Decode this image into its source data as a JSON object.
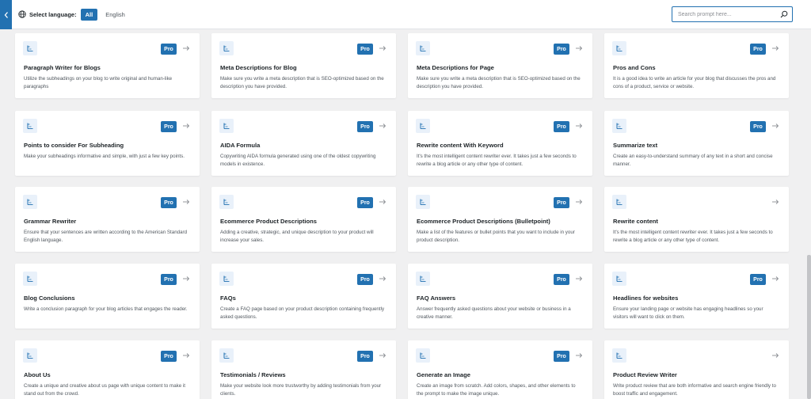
{
  "topbar": {
    "language_label": "Select language:",
    "lang_all": "All",
    "lang_english": "English",
    "search_placeholder": "Search prompt here..."
  },
  "badge_label": "Pro",
  "colors": {
    "accent": "#2271b1",
    "icon_bg": "#e9f1fa"
  },
  "cards": [
    {
      "title": "Paragraph Writer for Blogs",
      "desc": "Utilize the subheadings on your blog to write original and human-like paragraphs",
      "pro": true
    },
    {
      "title": "Meta Descriptions for Blog",
      "desc": "Make sure you write a meta description that is SEO-optimized based on the description you have provided.",
      "pro": true
    },
    {
      "title": "Meta Descriptions for Page",
      "desc": "Make sure you write a meta description that is SEO-optimized based on the description you have provided.",
      "pro": true
    },
    {
      "title": "Pros and Cons",
      "desc": "It is a good idea to write an article for your blog that discusses the pros and cons of a product, service or website.",
      "pro": true
    },
    {
      "title": "Points to consider For Subheading",
      "desc": "Make your subheadings informative and simple, with just a few key points.",
      "pro": true
    },
    {
      "title": "AIDA Formula",
      "desc": "Copywriting AIDA formula generated using one of the oldest copywriting models in existence.",
      "pro": true
    },
    {
      "title": "Rewrite content With Keyword",
      "desc": "It's the most intelligent content rewriter ever. It takes just a few seconds to rewrite a blog article or any other type of content.",
      "pro": true
    },
    {
      "title": "Summarize text",
      "desc": "Create an easy-to-understand summary of any text in a short and concise manner.",
      "pro": true
    },
    {
      "title": "Grammar Rewriter",
      "desc": "Ensure that your sentences are written according to the American Standard English language.",
      "pro": true
    },
    {
      "title": "Ecommerce Product Descriptions",
      "desc": "Adding a creative, strategic, and unique description to your product will increase your sales.",
      "pro": true
    },
    {
      "title": "Ecommerce Product Descriptions (Bulletpoint)",
      "desc": "Make a list of the features or bullet points that you want to include in your product description.",
      "pro": true
    },
    {
      "title": "Rewrite content",
      "desc": "It's the most intelligent content rewriter ever. It takes just a few seconds to rewrite a blog article or any other type of content.",
      "pro": false
    },
    {
      "title": "Blog Conclusions",
      "desc": "Write a conclusion paragraph for your blog articles that engages the reader.",
      "pro": true
    },
    {
      "title": "FAQs",
      "desc": "Create a FAQ page based on your product description containing frequently asked questions.",
      "pro": true
    },
    {
      "title": "FAQ Answers",
      "desc": "Answer frequently asked questions about your website or business in a creative manner.",
      "pro": true
    },
    {
      "title": "Headlines for websites",
      "desc": "Ensure your landing page or website has engaging headlines so your visitors will want to click on them.",
      "pro": true
    },
    {
      "title": "About Us",
      "desc": "Create a unique and creative about us page with unique content to make it stand out from the crowd.",
      "pro": true
    },
    {
      "title": "Testimonials / Reviews",
      "desc": "Make your website look more trustworthy by adding testimonials from your clients.",
      "pro": true
    },
    {
      "title": "Generate an Image",
      "desc": "Create an image from scratch. Add colors, shapes, and other elements to the prompt to make the image unique.",
      "pro": true
    },
    {
      "title": "Product Review Writer",
      "desc": "Write product review that are both informative and search engine friendly to boost traffic and engagement.",
      "pro": false
    }
  ]
}
